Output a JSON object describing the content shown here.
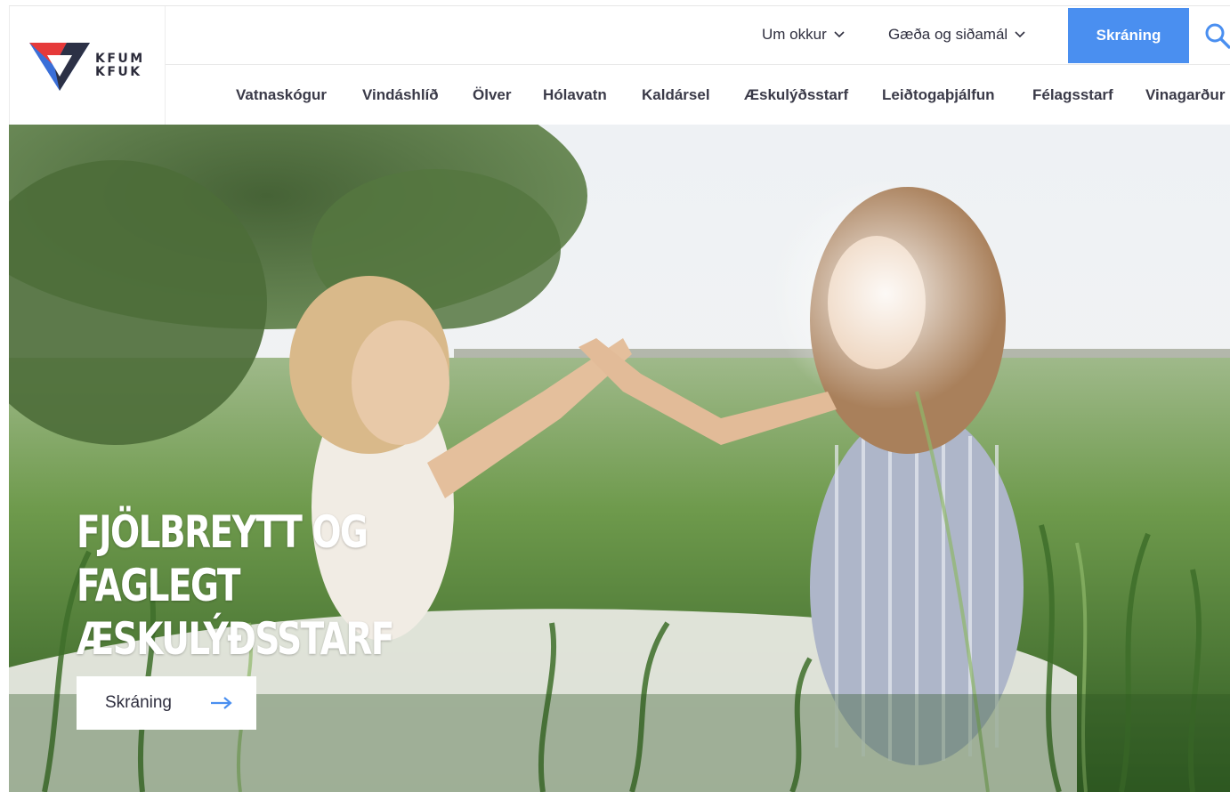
{
  "logo": {
    "line1": "KFUM",
    "line2": "KFUK"
  },
  "header": {
    "top_links": [
      {
        "label": "Um okkur"
      },
      {
        "label": "Gæða og siðamál"
      }
    ],
    "cta_label": "Skráning",
    "nav_items": [
      "Vatnaskógur",
      "Vindáshlíð",
      "Ölver",
      "Hólavatn",
      "Kaldársel",
      "Æskulýðsstarf",
      "Leiðtogaþjálfun",
      "Félagsstarf",
      "Vinagarður"
    ]
  },
  "hero": {
    "title_line1": "Fjölbreytt og faglegt",
    "title_line2": "æskulýðsstarf",
    "button_label": "Skráning"
  },
  "colors": {
    "accent": "#4a8ff0",
    "logo_red": "#e63a3a",
    "logo_blue": "#3a6fd8",
    "logo_dark": "#2b2b3a"
  }
}
